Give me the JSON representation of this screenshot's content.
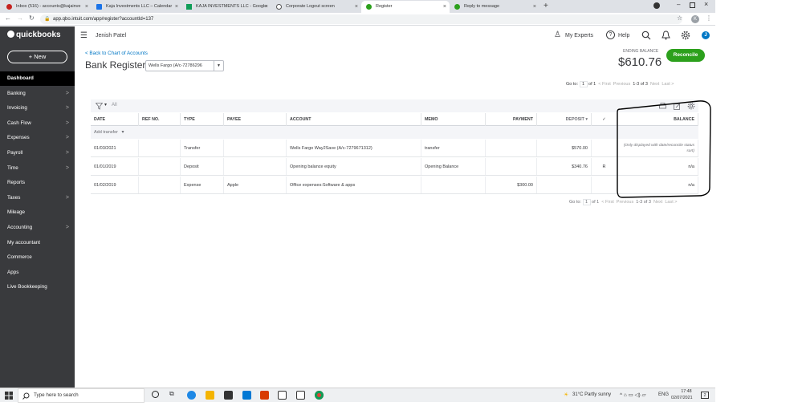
{
  "browser": {
    "tabs": [
      {
        "label": "Inbox (516) - accounts@kajainve",
        "color": "#c5221f"
      },
      {
        "label": "Kaja Investments LLC – Calendar",
        "color": "#1a73e8"
      },
      {
        "label": "KAJA INVESTMENTS LLC - Google",
        "color": "#0f9d58"
      },
      {
        "label": "Corporate Logout screen",
        "color": "#555555"
      },
      {
        "label": "Register",
        "color": "#2ca01c"
      },
      {
        "label": "Reply to message",
        "color": "#2ca01c"
      }
    ],
    "url": "app.qbo.intuit.com/app/register?accountId=137",
    "profile_initial": "K"
  },
  "app": {
    "logo_small": "intuit",
    "logo": "quickbooks",
    "company": "Jenish Patel",
    "my_experts": "My Experts",
    "help": "Help",
    "avatar": "J",
    "new_button": "+ New"
  },
  "sidebar": {
    "items": [
      {
        "label": "Dashboard",
        "chev": ""
      },
      {
        "label": "Banking",
        "chev": ">"
      },
      {
        "label": "Invoicing",
        "chev": ">"
      },
      {
        "label": "Cash Flow",
        "chev": ">"
      },
      {
        "label": "Expenses",
        "chev": ">"
      },
      {
        "label": "Payroll",
        "chev": ">"
      },
      {
        "label": "Time",
        "chev": ">"
      },
      {
        "label": "Reports",
        "chev": ""
      },
      {
        "label": "Taxes",
        "chev": ">"
      },
      {
        "label": "Mileage",
        "chev": ""
      },
      {
        "label": "Accounting",
        "chev": ">"
      },
      {
        "label": "My accountant",
        "chev": ""
      },
      {
        "label": "Commerce",
        "chev": ""
      },
      {
        "label": "Apps",
        "chev": ""
      },
      {
        "label": "Live Bookkeeping",
        "chev": ""
      }
    ]
  },
  "register": {
    "back_link": "< Back to Chart of Accounts",
    "title": "Bank Register",
    "account": "Wells Fargo (A/c-72786296",
    "ending_balance_label": "ENDING BALANCE",
    "ending_balance": "$610.76",
    "reconcile": "Reconcile",
    "pager": {
      "goto": "Go to:",
      "page": "1",
      "of": "of 1",
      "first": "< First",
      "previous": "Previous",
      "range": "1-3 of 3",
      "next": "Next",
      "last": "Last >"
    },
    "filter_label": "All",
    "columns": [
      "DATE",
      "REF NO.",
      "TYPE",
      "PAYEE",
      "ACCOUNT",
      "MEMO",
      "PAYMENT",
      "DEPOSIT ▾",
      "✓",
      "BALANCE"
    ],
    "add_transfer": "Add transfer",
    "rows": [
      {
        "date": "01/03/2021",
        "ref": "",
        "type": "Transfer",
        "payee": "",
        "account": "Wells Fargo Way2Save (A/c-7279671312)",
        "memo": "transfer",
        "payment": "",
        "deposit": "$570.00",
        "check": "",
        "balance": "(Only displayed with date/reconcile status sort)"
      },
      {
        "date": "01/01/2019",
        "ref": "",
        "type": "Deposit",
        "payee": "",
        "account": "Opening balance equity",
        "memo": "Opening Balance",
        "payment": "",
        "deposit": "$340.76",
        "check": "R",
        "balance": "n/a"
      },
      {
        "date": "01/02/2019",
        "ref": "",
        "type": "Expense",
        "payee": "Apple",
        "account": "Office expenses:Software & apps",
        "memo": "",
        "payment": "$300.00",
        "deposit": "",
        "check": "",
        "balance": "n/a"
      }
    ]
  },
  "taskbar": {
    "search": "Type here to search",
    "weather": "31°C  Partly sunny",
    "lang": "ENG",
    "time": "17:48",
    "date": "02/07/2021",
    "notif": "2"
  }
}
